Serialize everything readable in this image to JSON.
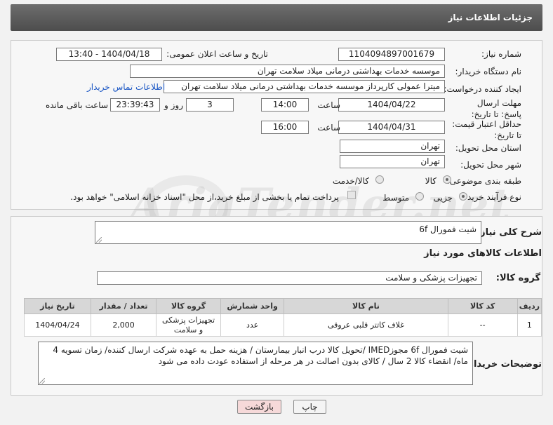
{
  "header": {
    "title": "جزئیات اطلاعات نیاز"
  },
  "form": {
    "need_number_label": "شماره نیاز:",
    "need_number": "1104094897001679",
    "announce_label": "تاریخ و ساعت اعلان عمومی:",
    "announce_value": "1404/04/18 - 13:40",
    "buyer_org_label": "نام دستگاه خریدار:",
    "buyer_org": "موسسه خدمات بهداشتی درمانی میلاد سلامت تهران",
    "creator_label": "ایجاد کننده درخواست:",
    "creator": "میترا عمولی کارپرداز موسسه خدمات بهداشتی درمانی میلاد سلامت تهران",
    "contact_link": "اطلاعات تماس خریدار",
    "deadline_label": "مهلت ارسال پاسخ: تا تاریخ:",
    "deadline_date": "1404/04/22",
    "time_label": "ساعت",
    "deadline_time": "14:00",
    "days_value": "3",
    "days_label": "روز و",
    "remaining_time": "23:39:43",
    "remaining_label": "ساعت باقی مانده",
    "min_price_label": "حداقل اعتبار قیمت: تا تاریخ:",
    "price_date": "1404/04/31",
    "price_time_label": "ساعت",
    "price_time": "16:00",
    "province_label": "استان محل تحویل:",
    "province": "تهران",
    "city_label": "شهر محل تحویل:",
    "city": "تهران",
    "category_label": "طبقه بندی موضوعی:",
    "category_goods": "کالا",
    "category_goods_service": "کالا/خدمت",
    "process_label": "نوع فرآیند خرید :",
    "process_minor": "جزیی",
    "process_medium": "متوسط",
    "payment_note": "پرداخت تمام یا بخشی از مبلغ خرید،از محل \"اسناد خزانه اسلامی\" خواهد بود."
  },
  "description": {
    "label": "شرح کلی نیاز:",
    "value": "شیت فمورال 6f"
  },
  "goods": {
    "section_title": "اطلاعات کالاهای مورد نیاز",
    "group_label": "گروه کالا:",
    "group_value": "تجهیزات پزشکی و سلامت",
    "columns": [
      "ردیف",
      "کد کالا",
      "نام کالا",
      "واحد شمارش",
      "گروه کالا",
      "تعداد / مقدار",
      "تاریخ نیاز"
    ],
    "rows": [
      {
        "row": "1",
        "code": "--",
        "name": "غلاف کاتتر قلبی عروقی",
        "unit": "عدد",
        "group": "تجهیزات پزشکی و سلامت",
        "qty": "2,000",
        "date": "1404/04/24"
      }
    ]
  },
  "buyer_notes": {
    "label": "توضیحات خریدار:",
    "value": "شیت فمورال 6f  مجوزIMED /تحویل کالا درب انبار بیمارستان / هزینه حمل به عهده شرکت ارسال کننده/ زمان تسویه 4 ماه/ انقضاء کالا 2 سال / کالای بدون اصالت در هر مرحله از استفاده عودت داده می شود"
  },
  "buttons": {
    "print": "چاپ",
    "back": "بازگشت"
  },
  "colors": {
    "title_bar": "#555555",
    "link": "#1a56c4",
    "back_button": "#f6d9d9"
  },
  "watermark": "AriaTender.net"
}
